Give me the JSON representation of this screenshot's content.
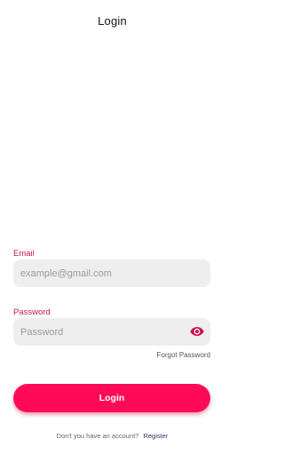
{
  "header": {
    "title": "Login"
  },
  "form": {
    "email_label": "Email",
    "email_placeholder": "example@gmail.com",
    "email_value": "",
    "password_label": "Password",
    "password_placeholder": "Password",
    "password_value": "",
    "password_toggle_icon": "eye-icon",
    "forgot_password": "Forgot Password",
    "submit_label": "Login"
  },
  "footer": {
    "prompt": "Don't you have an account?",
    "register_link": "Register"
  },
  "colors": {
    "accent": "#ff0a58",
    "label": "#c8145a",
    "input_bg": "#eeeeee"
  }
}
